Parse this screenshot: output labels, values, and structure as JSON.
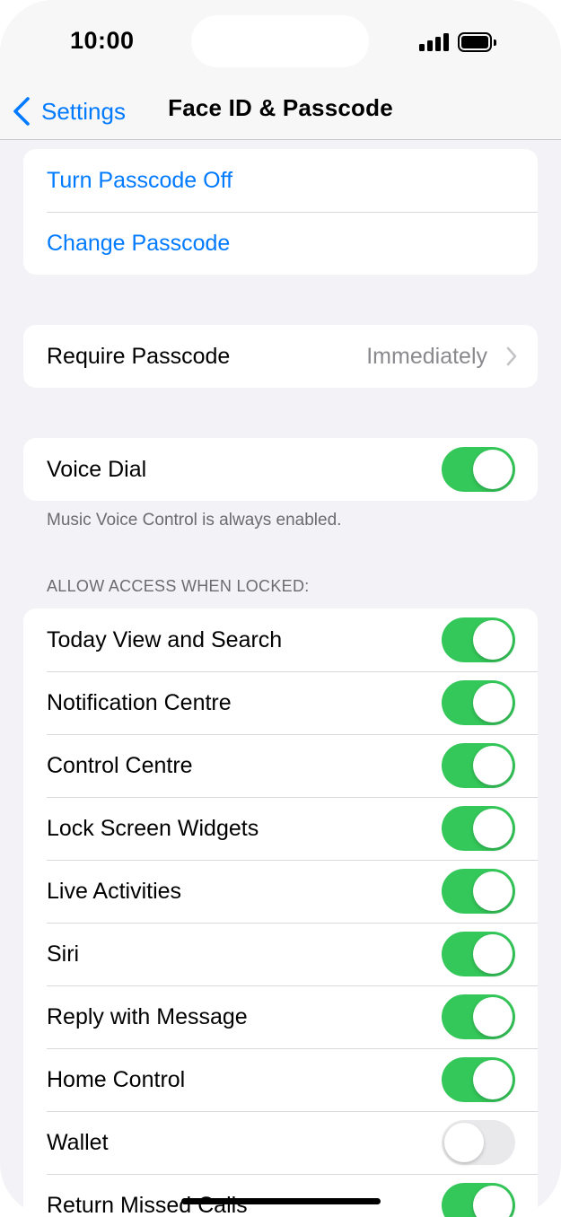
{
  "status_bar": {
    "time": "10:00"
  },
  "nav": {
    "back_label": "Settings",
    "title": "Face ID & Passcode"
  },
  "passcode_group": {
    "turn_off": "Turn Passcode Off",
    "change": "Change Passcode"
  },
  "require": {
    "label": "Require Passcode",
    "value": "Immediately"
  },
  "voice_dial": {
    "label": "Voice Dial",
    "on": true,
    "note": "Music Voice Control is always enabled."
  },
  "locked_access": {
    "header": "ALLOW ACCESS WHEN LOCKED:",
    "items": [
      {
        "label": "Today View and Search",
        "on": true
      },
      {
        "label": "Notification Centre",
        "on": true
      },
      {
        "label": "Control Centre",
        "on": true
      },
      {
        "label": "Lock Screen Widgets",
        "on": true
      },
      {
        "label": "Live Activities",
        "on": true
      },
      {
        "label": "Siri",
        "on": true
      },
      {
        "label": "Reply with Message",
        "on": true
      },
      {
        "label": "Home Control",
        "on": true
      },
      {
        "label": "Wallet",
        "on": false
      },
      {
        "label": "Return Missed Calls",
        "on": true
      }
    ]
  },
  "colors": {
    "accent": "#007aff",
    "toggle_on": "#34c759",
    "toggle_off": "#e9e9eb",
    "background": "#f2f2f7"
  }
}
